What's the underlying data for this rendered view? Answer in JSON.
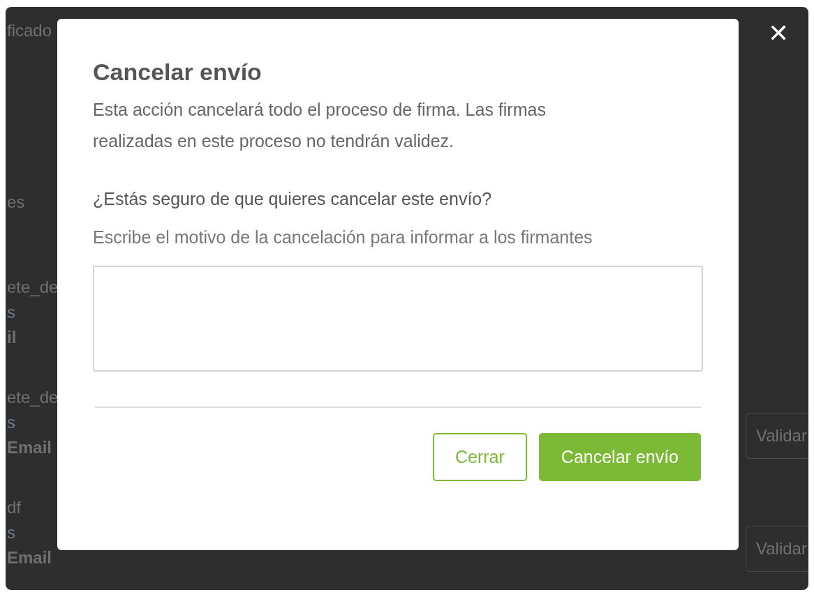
{
  "background": {
    "left_groups": [
      {
        "lines": [
          {
            "text": "ficado",
            "kind": "plain"
          }
        ]
      },
      {
        "lines": [
          {
            "text": "es",
            "kind": "plain"
          }
        ]
      },
      {
        "lines": [
          {
            "text": "ete_de",
            "kind": "plain"
          },
          {
            "text": "s",
            "kind": "link"
          },
          {
            "text": "il",
            "kind": "bold"
          }
        ]
      },
      {
        "lines": [
          {
            "text": "ete_de",
            "kind": "plain"
          },
          {
            "text": "s",
            "kind": "link"
          },
          {
            "text": "Email",
            "kind": "bold"
          }
        ]
      },
      {
        "lines": [
          {
            "text": "df",
            "kind": "plain"
          },
          {
            "text": "s",
            "kind": "link"
          },
          {
            "text": "Email",
            "kind": "bold"
          }
        ]
      }
    ],
    "right_buttons": [
      "Validar",
      "Validar"
    ]
  },
  "close_symbol": "✕",
  "dialog": {
    "title": "Cancelar envío",
    "description": "Esta acción cancelará todo el proceso de firma. Las firmas realizadas en este proceso no tendrán validez.",
    "question": "¿Estás seguro de que quieres cancelar este envío?",
    "instruction": "Escribe el motivo de la cancelación para informar a los firmantes",
    "buttons": [
      {
        "label": "Cerrar",
        "kind": "secondary"
      },
      {
        "label": "Cancelar envío",
        "kind": "primary"
      }
    ]
  }
}
